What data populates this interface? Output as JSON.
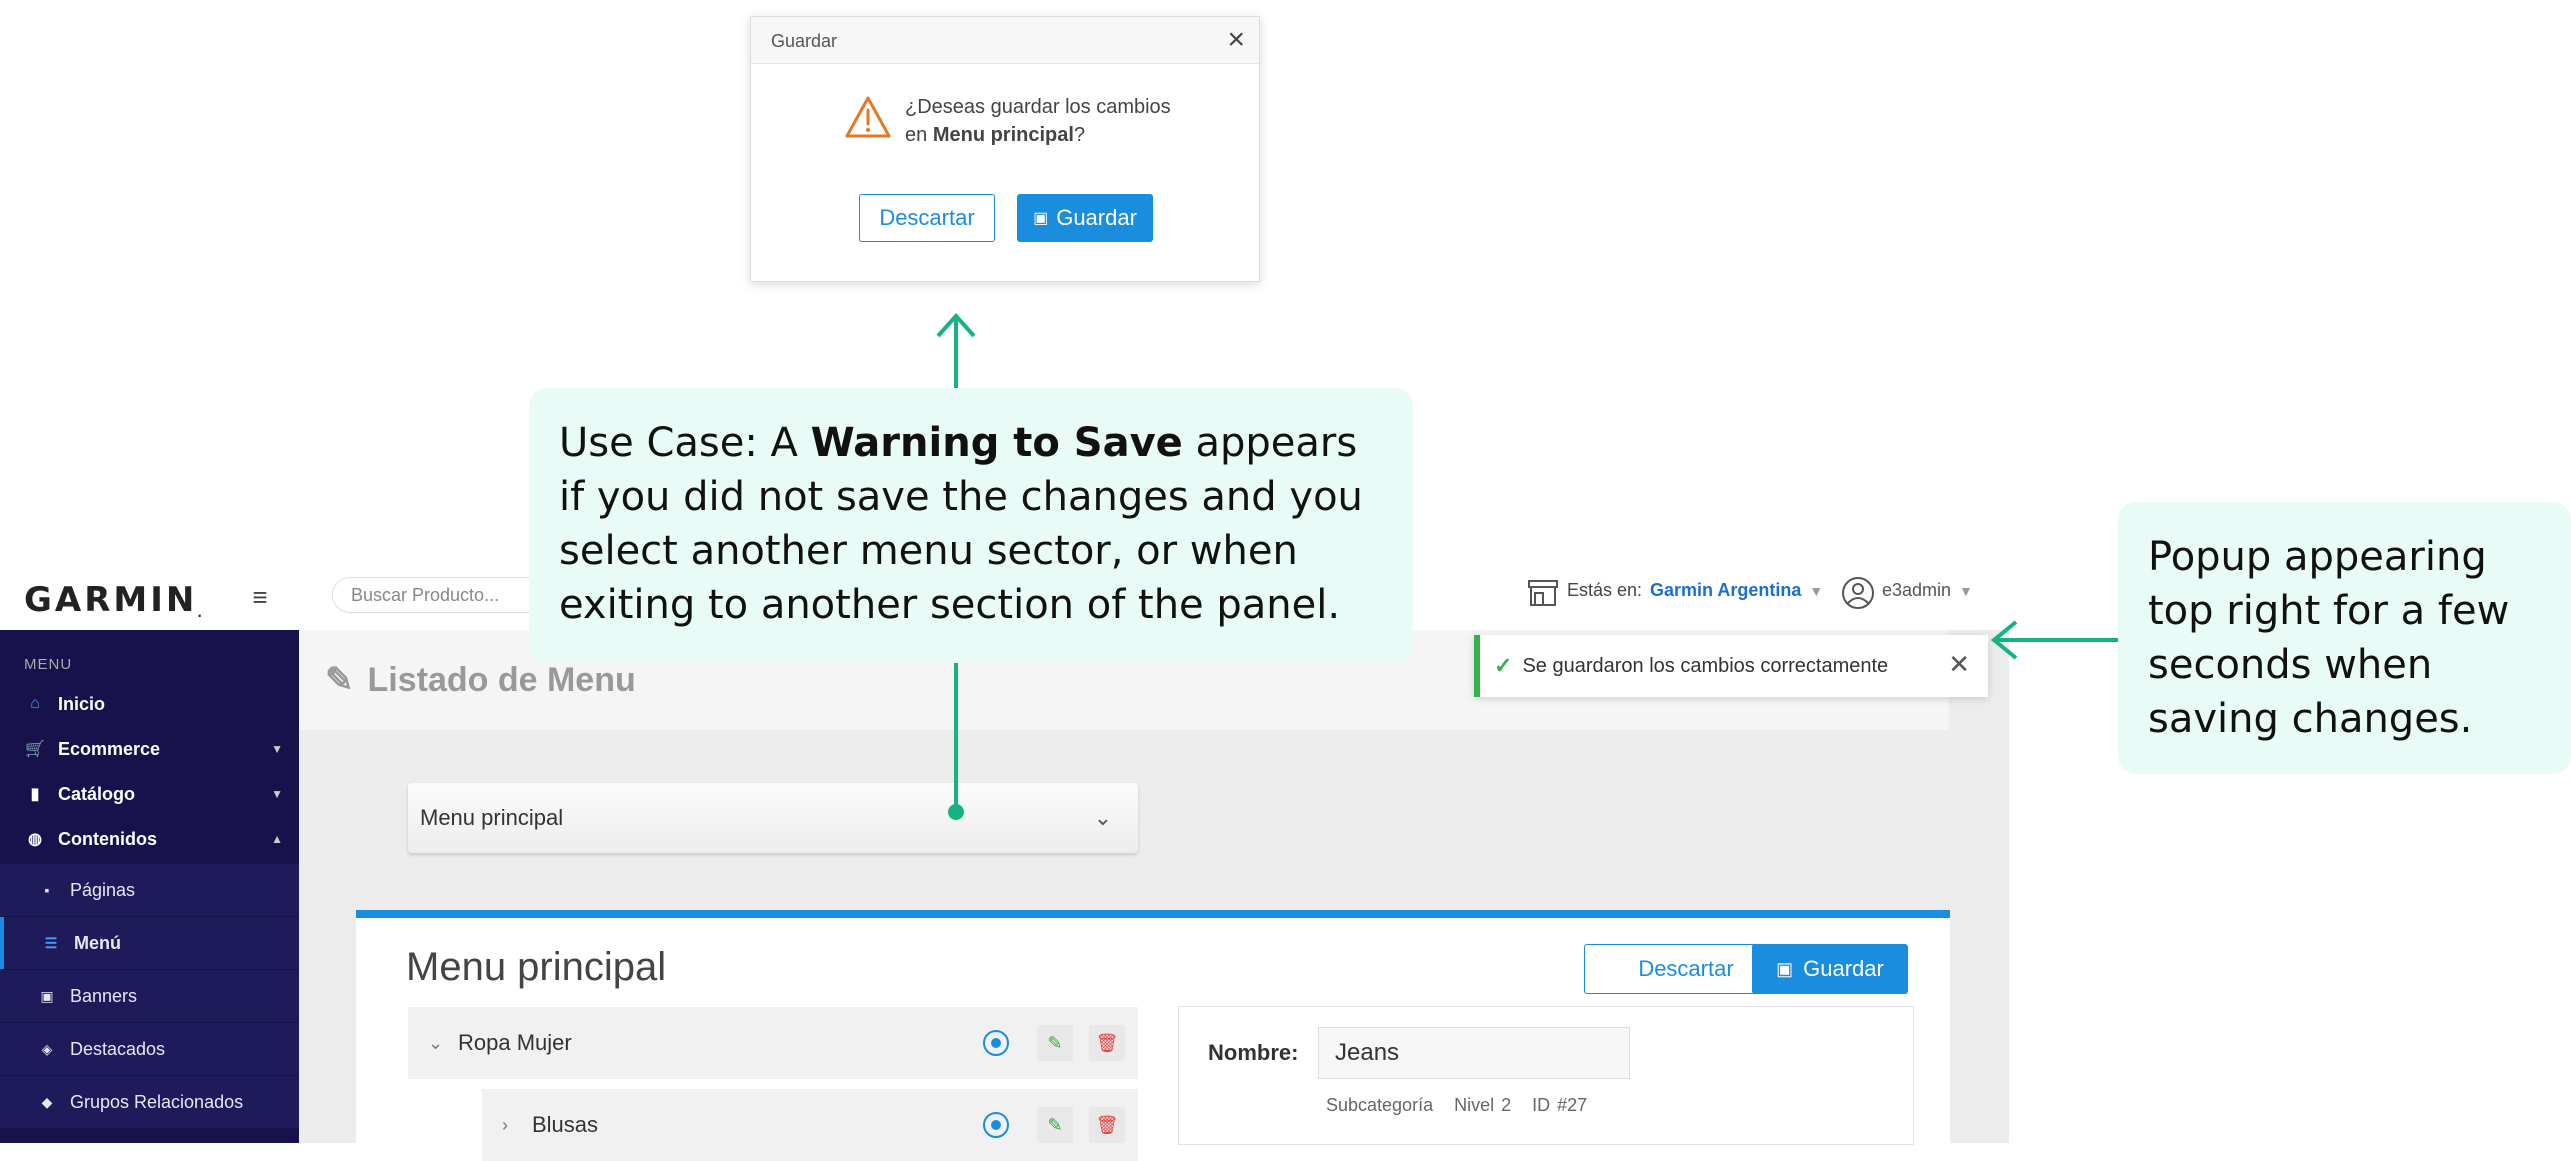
{
  "header": {
    "logo": "GARMIN",
    "search_placeholder": "Buscar Producto...",
    "store_label": "Estás en:",
    "store_value": "Garmin Argentina",
    "user": "e3admin"
  },
  "sidebar": {
    "section_title": "MENU",
    "items": [
      {
        "label": "Inicio",
        "icon": "home-icon"
      },
      {
        "label": "Ecommerce",
        "icon": "cart-icon"
      },
      {
        "label": "Catálogo",
        "icon": "book-icon"
      },
      {
        "label": "Contenidos",
        "icon": "globe-icon"
      }
    ],
    "subitems": [
      {
        "label": "Páginas",
        "icon": "page-icon"
      },
      {
        "label": "Menú",
        "icon": "list-icon"
      },
      {
        "label": "Banners",
        "icon": "image-icon"
      },
      {
        "label": "Destacados",
        "icon": "tag-icon"
      },
      {
        "label": "Grupos Relacionados",
        "icon": "tags-icon"
      }
    ]
  },
  "main": {
    "page_title": "Listado de Menu",
    "dropdown_value": "Menu principal",
    "panel_title": "Menu principal",
    "discard_label": "Descartar",
    "save_label": "Guardar",
    "tree": [
      {
        "label": "Ropa Mujer"
      },
      {
        "label": "Blusas"
      }
    ],
    "detail": {
      "name_label": "Nombre:",
      "name_value": "Jeans",
      "type": "Subcategoría",
      "level": "Nivel 2",
      "id": "ID #27"
    }
  },
  "toast": {
    "message": "Se guardaron los cambios correctamente"
  },
  "modal": {
    "title": "Guardar",
    "message_line1": "¿Deseas guardar los cambios",
    "message_prefix": "en ",
    "message_menu": "Menu principal",
    "message_suffix": "?",
    "discard_label": "Descartar",
    "save_label": "Guardar"
  },
  "annotations": {
    "main_prefix": "Use Case: A ",
    "main_bold": "Warning to Save",
    "main_suffix": " appears if you did not save the changes and you select another menu sector, or when exiting to another section of the panel.",
    "side": "Popup appearing top right for a few seconds when saving changes."
  },
  "colors": {
    "accent": "#1a8ddf",
    "sidebar": "#17124b",
    "annotation": "#15b383",
    "success": "#34b34a",
    "warning": "#e87722"
  }
}
